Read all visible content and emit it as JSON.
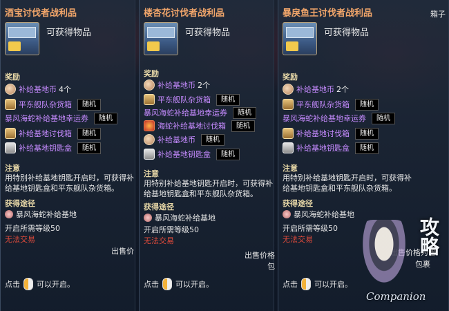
{
  "panels": [
    {
      "title": "酒宝讨伐者战利品",
      "obtain_label": "可获得物品",
      "reward_heading": "奖励",
      "rewards": [
        {
          "name": "补给基地币",
          "qty": "4个",
          "badge": "",
          "icon": "coin-icon"
        },
        {
          "name": "平东舰队杂货箱",
          "qty": "",
          "badge": "随机",
          "icon": "chest-icon"
        },
        {
          "name": "暴风海蛇补给基地幸运券",
          "qty": "",
          "badge": "随机",
          "icon": ""
        },
        {
          "name": "补给基地讨伐箱",
          "qty": "",
          "badge": "随机",
          "icon": "chest-icon"
        },
        {
          "name": "补给基地钥匙盒",
          "qty": "",
          "badge": "随机",
          "icon": "box-icon"
        }
      ],
      "note_heading": "注意",
      "note_text": "用特别补给基地钥匙开启时，可获得补给基地钥匙盒和平东舰队杂货箱。",
      "source_heading": "获得途径",
      "source": "暴风海蛇补给基地",
      "level": "开启所需等级50",
      "no_trade": "无法交易",
      "sell": "出售价",
      "click_pre": "点击",
      "click_post": "可以开启。"
    },
    {
      "title": "楼杏花讨伐者战利品",
      "obtain_label": "可获得物品",
      "reward_heading": "奖励",
      "rewards": [
        {
          "name": "补给基地币",
          "qty": "2个",
          "badge": "",
          "icon": "coin-icon"
        },
        {
          "name": "平东舰队杂货箱",
          "qty": "",
          "badge": "随机",
          "icon": "chest-icon"
        },
        {
          "name": "暴风海蛇补给基地幸运券",
          "qty": "",
          "badge": "随机",
          "icon": ""
        },
        {
          "name": "海蛇补给基地讨伐箱",
          "qty": "",
          "badge": "随机",
          "icon": "fire-icon"
        },
        {
          "name": "补给基地币",
          "qty": "",
          "badge": "随机",
          "icon": "coin-icon"
        },
        {
          "name": "补给基地钥匙盒",
          "qty": "",
          "badge": "随机",
          "icon": "box-icon"
        }
      ],
      "note_heading": "注意",
      "note_text": "用特别补给基地钥匙开启时，可获得补给基地钥匙盒和平东舰队杂货箱。",
      "source_heading": "获得途径",
      "source": "暴风海蛇补给基地",
      "level": "开启所需等级50",
      "no_trade": "无法交易",
      "sell": "出售价格",
      "sell2": "包",
      "click_pre": "点击",
      "click_post": "可以开启。"
    },
    {
      "title": "暴戾鱼王讨伐者战利品",
      "obtain_label": "可获得物品",
      "corner": "箱子",
      "reward_heading": "奖励",
      "rewards": [
        {
          "name": "补给基地币",
          "qty": "2个",
          "badge": "",
          "icon": "coin-icon"
        },
        {
          "name": "平东舰队杂货箱",
          "qty": "",
          "badge": "随机",
          "icon": "chest-icon"
        },
        {
          "name": "暴风海蛇补给基地幸运券",
          "qty": "",
          "badge": "随机",
          "icon": ""
        },
        {
          "name": "补给基地讨伐箱",
          "qty": "",
          "badge": "随机",
          "icon": "chest-icon"
        },
        {
          "name": "补给基地钥匙盒",
          "qty": "",
          "badge": "随机",
          "icon": "box-icon"
        }
      ],
      "note_heading": "注意",
      "note_text": "用特别补给基地钥匙开启时，可获得补给基地钥匙盒和平东舰队杂货箱。",
      "source_heading": "获得途径",
      "source": "暴风海蛇补给基地",
      "level": "开启所需等级50",
      "no_trade": "无法交易",
      "sell": "出售价格为普",
      "sell2": "包裹",
      "click_pre": "点击",
      "click_post": "可以开启。"
    }
  ],
  "watermark": "Companion",
  "watermark_logo": "攻略"
}
